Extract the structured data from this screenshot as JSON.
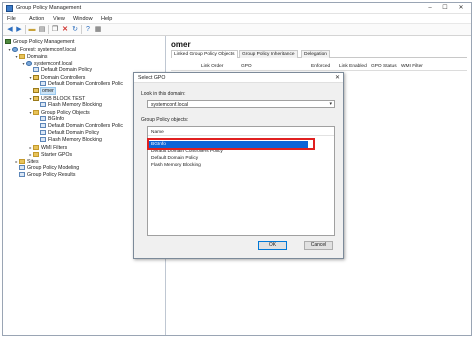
{
  "window": {
    "title": "Group Policy Management",
    "controls": [
      "–",
      "☐",
      "✕"
    ]
  },
  "menu": [
    "File",
    "Action",
    "View",
    "Window",
    "Help"
  ],
  "tree": [
    {
      "label": "Group Policy Management",
      "icon": "root"
    },
    {
      "label": "Forest: systemconf.local",
      "icon": "forest"
    },
    {
      "label": "Domains",
      "icon": "folder"
    },
    {
      "label": "systemconf.local",
      "icon": "forest"
    },
    {
      "label": "Default Domain Policy",
      "icon": "gpo"
    },
    {
      "label": "Domain Controllers",
      "icon": "ou"
    },
    {
      "label": "Default Domain Controllers Polic",
      "icon": "gpo"
    },
    {
      "label": "omer",
      "icon": "ou",
      "selected": true
    },
    {
      "label": "USB BLOCK TEST",
      "icon": "ou"
    },
    {
      "label": "Flash Memory Blocking",
      "icon": "gpo"
    },
    {
      "label": "Group Policy Objects",
      "icon": "folder"
    },
    {
      "label": "BGInfo",
      "icon": "gpo"
    },
    {
      "label": "Default Domain Controllers Polic",
      "icon": "gpo"
    },
    {
      "label": "Default Domain Policy",
      "icon": "gpo"
    },
    {
      "label": "Flash Memory Blocking",
      "icon": "gpo"
    },
    {
      "label": "WMI Filters",
      "icon": "folder"
    },
    {
      "label": "Starter GPOs",
      "icon": "folder"
    },
    {
      "label": "Sites",
      "icon": "folder"
    },
    {
      "label": "Group Policy Modeling",
      "icon": "gpo"
    },
    {
      "label": "Group Policy Results",
      "icon": "gpo"
    }
  ],
  "details": {
    "heading": "omer",
    "tabs": [
      "Linked Group Policy Objects",
      "Group Policy Inheritance",
      "Delegation"
    ],
    "columns": [
      "Link Order",
      "GPO",
      "Enforced",
      "Link Enabled",
      "GPO Status",
      "WMI Filter"
    ]
  },
  "dialog": {
    "title": "Select GPO",
    "close": "✕",
    "domain_label": "Look in this domain:",
    "domain_value": "systemconf.local",
    "objects_label": "Group Policy objects:",
    "list_header": "Name",
    "items": [
      "BGInfo",
      "Default Domain Controllers Policy",
      "Default Domain Policy",
      "Flash Memory Blocking"
    ],
    "selected_index": 0,
    "ok_label": "OK",
    "cancel_label": "Cancel"
  },
  "colors": {
    "selection": "#0a64d8",
    "highlight_box": "#e02020"
  }
}
